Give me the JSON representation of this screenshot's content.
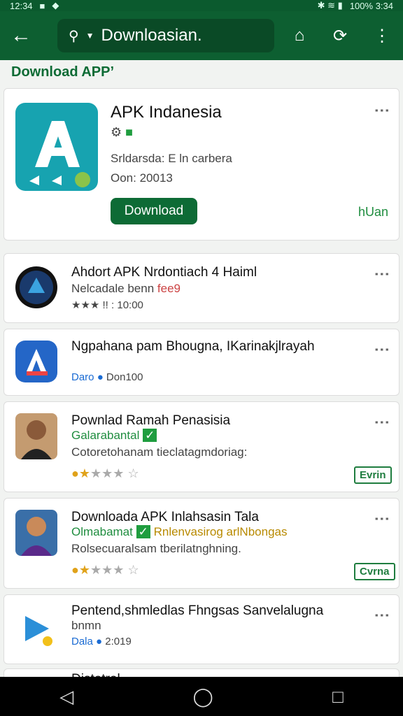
{
  "status_bar": {
    "left": "12:34",
    "right": "100%  3:34"
  },
  "toolbar": {
    "search_text": "Downloasian.",
    "search_icon": "search-icon",
    "back_icon": "back-arrow-icon"
  },
  "section": {
    "title": "Download APP’"
  },
  "featured": {
    "name": "APK Indanesia",
    "developer": "Srldarsda: E ln carbera",
    "date": "Oon: 20013",
    "button": "Download",
    "link": "hUan"
  },
  "items": [
    {
      "title": "Ahdort APK Nrdontiach 4 Haiml",
      "title_green": "APK",
      "sub": "Nelcadale benn",
      "sub_red": "fee9",
      "meta": "★★★  !! : 10:00"
    },
    {
      "title": "Ngpahana pam Bhougna, IKarinakjlrayah",
      "meta_a": "Daro",
      "meta_b": "Don100"
    },
    {
      "title": "Pownlad Ramah Penasisia",
      "sub": "Galarabantal",
      "desc": "Cotoretohanam tieclatagmdoriag:",
      "badge": "Evrin"
    },
    {
      "title": "Downloada APK Inlahsasin Tala",
      "sub": "Olmabamat",
      "sub_extra": "Rnlenvasirog arlNbongas",
      "desc": "Rolsecuaralsam tberilatnghning.",
      "badge": "Cvrna"
    },
    {
      "title": "Pentend,shmledlas Fhngsas Sanvelalugna",
      "sub": "bnmn",
      "meta_a": "Dala",
      "meta_b": "2:019"
    },
    {
      "title": "Distotrol"
    }
  ],
  "colors": {
    "primary": "#0d5f31",
    "accent": "#1f9d3f",
    "star": "#e0a21a"
  }
}
